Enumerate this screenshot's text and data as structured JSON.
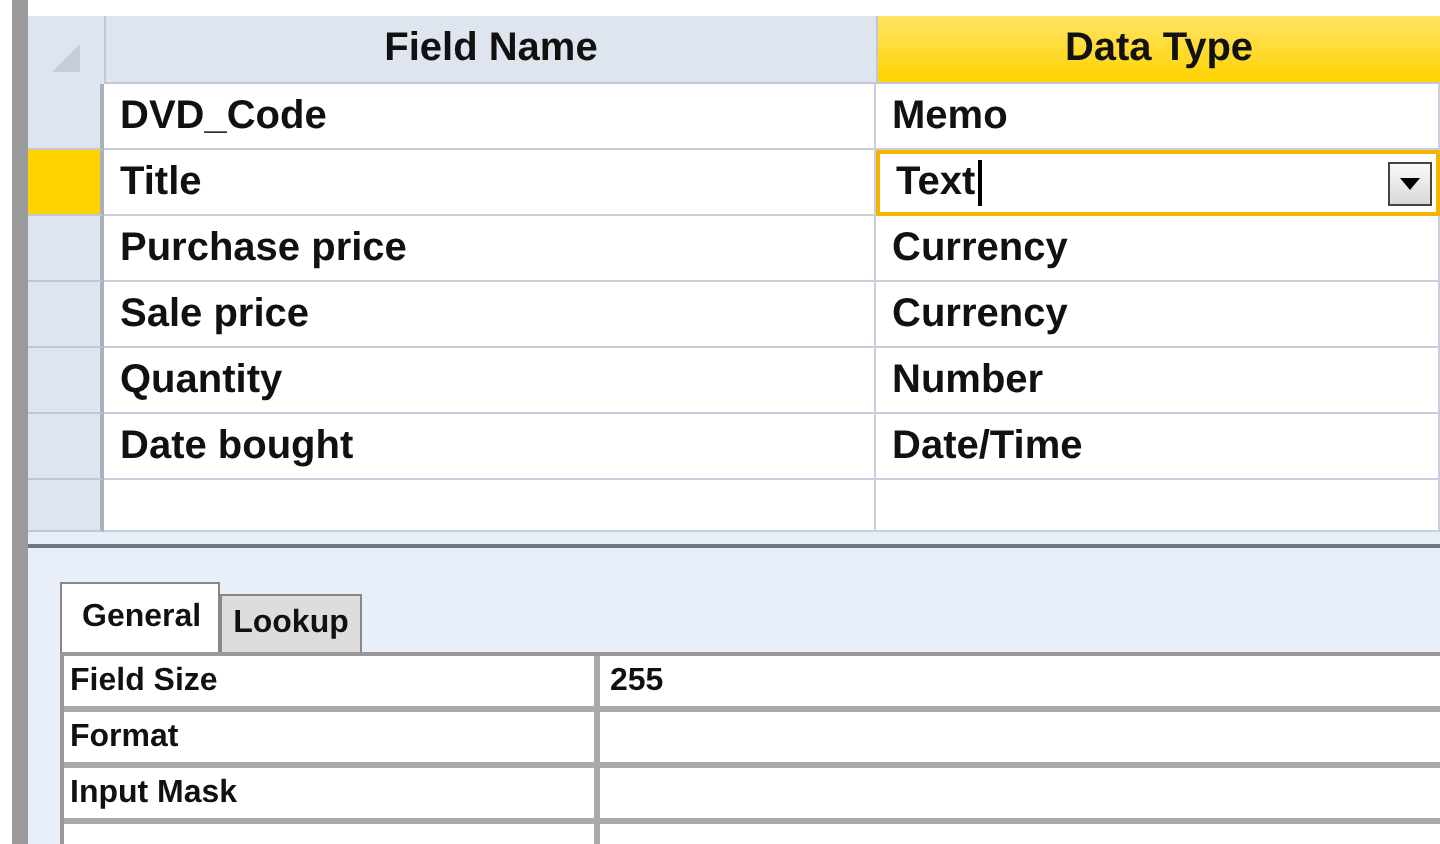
{
  "columns": [
    {
      "label": "Field Name",
      "selected": false
    },
    {
      "label": "Data Type",
      "selected": true
    }
  ],
  "rows": [
    {
      "field_name": "DVD_Code",
      "data_type": "Memo",
      "selected": false
    },
    {
      "field_name": "Title",
      "data_type": "Text",
      "selected": true
    },
    {
      "field_name": "Purchase price",
      "data_type": "Currency",
      "selected": false
    },
    {
      "field_name": "Sale price",
      "data_type": "Currency",
      "selected": false
    },
    {
      "field_name": "Quantity",
      "data_type": "Number",
      "selected": false
    },
    {
      "field_name": "Date bought",
      "data_type": "Date/Time",
      "selected": false
    }
  ],
  "tabs": [
    {
      "label": "General",
      "selected": true
    },
    {
      "label": "Lookup",
      "selected": false
    }
  ],
  "properties": [
    {
      "name": "Field Size",
      "value": "255"
    },
    {
      "name": "Format"
    },
    {
      "name": "Input Mask"
    }
  ]
}
